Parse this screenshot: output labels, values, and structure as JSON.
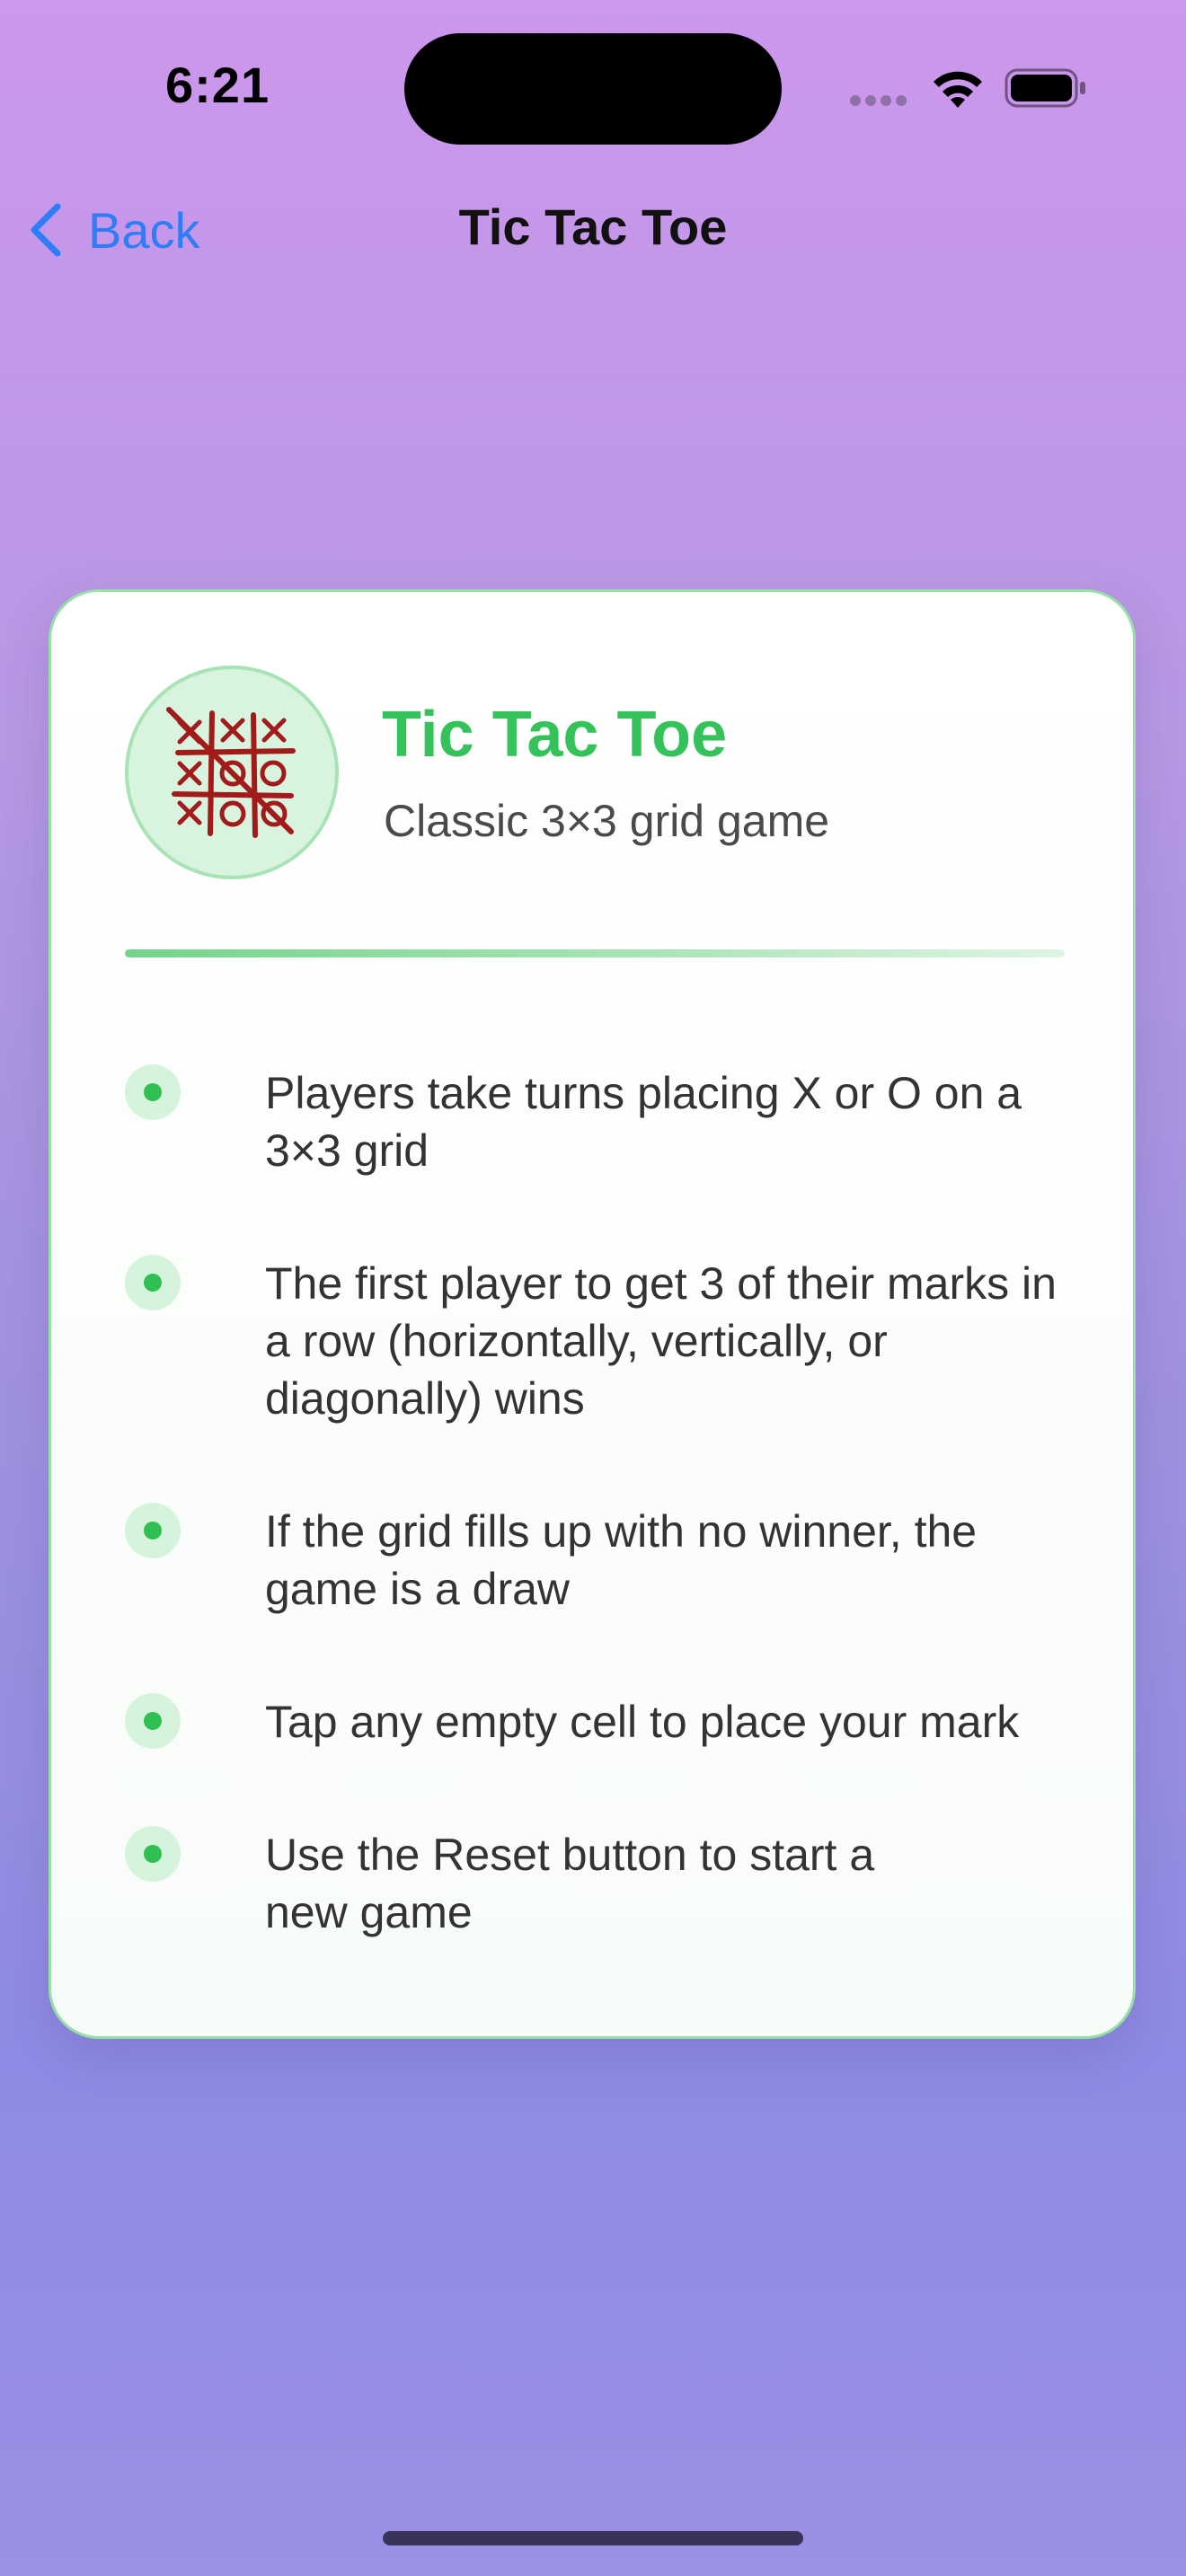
{
  "status_bar": {
    "time": "6:21",
    "icons": [
      "signal-dots-icon",
      "wifi-icon",
      "battery-icon"
    ]
  },
  "nav": {
    "back_label": "Back",
    "title": "Tic Tac Toe"
  },
  "card": {
    "icon": "tic-tac-toe-grid-icon",
    "title": "Tic Tac Toe",
    "subtitle": "Classic 3×3 grid game",
    "rules": [
      "Players take turns placing X or O on a 3×3 grid",
      "The first player to get 3 of their marks in a row (horizontally, vertically, or diagonally) wins",
      "If the grid fills up with no winner, the game is a draw",
      "Tap any empty cell to place your mark",
      "Use the Reset button to start a new game"
    ]
  },
  "colors": {
    "accent_green": "#36c25a",
    "link_blue": "#2f7df6",
    "icon_red": "#a11b1b"
  }
}
